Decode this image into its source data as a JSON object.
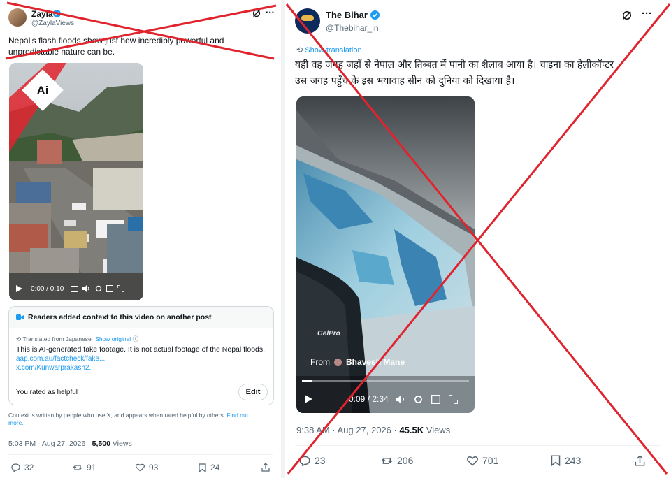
{
  "left": {
    "author": {
      "name": "Zayla",
      "handle": "@ZaylaViews"
    },
    "text_lines": [
      "Nepal's flash floods show just how incredibly powerful and",
      "unpredictable nature can be."
    ],
    "ai_badge": "Ai",
    "video": {
      "time": "0:00 / 0:10"
    },
    "context": {
      "header": "Readers added context to this video on another post",
      "translated_from": "Translated from Japanese",
      "show_original": "Show original",
      "body": "This is AI-generated fake footage. It is not actual footage of the Nepal floods.",
      "link1": "aap.com.au/factcheck/fake...",
      "link2": "x.com/Kunwarprakash2...",
      "rated": "You rated as helpful",
      "edit": "Edit"
    },
    "footnote": "Context is written by people who use X, and appears when rated helpful by others.",
    "find_out": "Find out",
    "more": "more.",
    "meta": {
      "time": "5:03 PM · Aug 27, 2026 · ",
      "views_count": "5,500",
      "views_label": " Views"
    },
    "actions": {
      "replies": "32",
      "reposts": "91",
      "likes": "93",
      "bookmarks": "24"
    }
  },
  "right": {
    "author": {
      "name": "The Bihar",
      "handle": "@Thebihar_in"
    },
    "show_translation": "Show translation",
    "text_lines": [
      "यही वह जगह जहाँ से नेपाल और तिब्बत में पानी का शैलाब आया है। चाइना का हेलीकॉप्टर",
      "उस जगह पहुँच के इस भयावाह सीन को दुनिया को दिखाया है।"
    ],
    "video": {
      "from_label": "From",
      "from_name": "Bhavesh Mane",
      "time": "0:09 / 2:34",
      "boat_text": "GelPro"
    },
    "meta": {
      "time": "9:38 AM · Aug 27, 2026 · ",
      "views_count": "45.5K",
      "views_label": " Views"
    },
    "actions": {
      "replies": "23",
      "reposts": "206",
      "likes": "701",
      "bookmarks": "243"
    }
  },
  "colors": {
    "cross": "#e0242e",
    "link": "#1d9bf0",
    "verified": "#1d9bf0",
    "text": "#0f1419",
    "muted": "#536471"
  }
}
